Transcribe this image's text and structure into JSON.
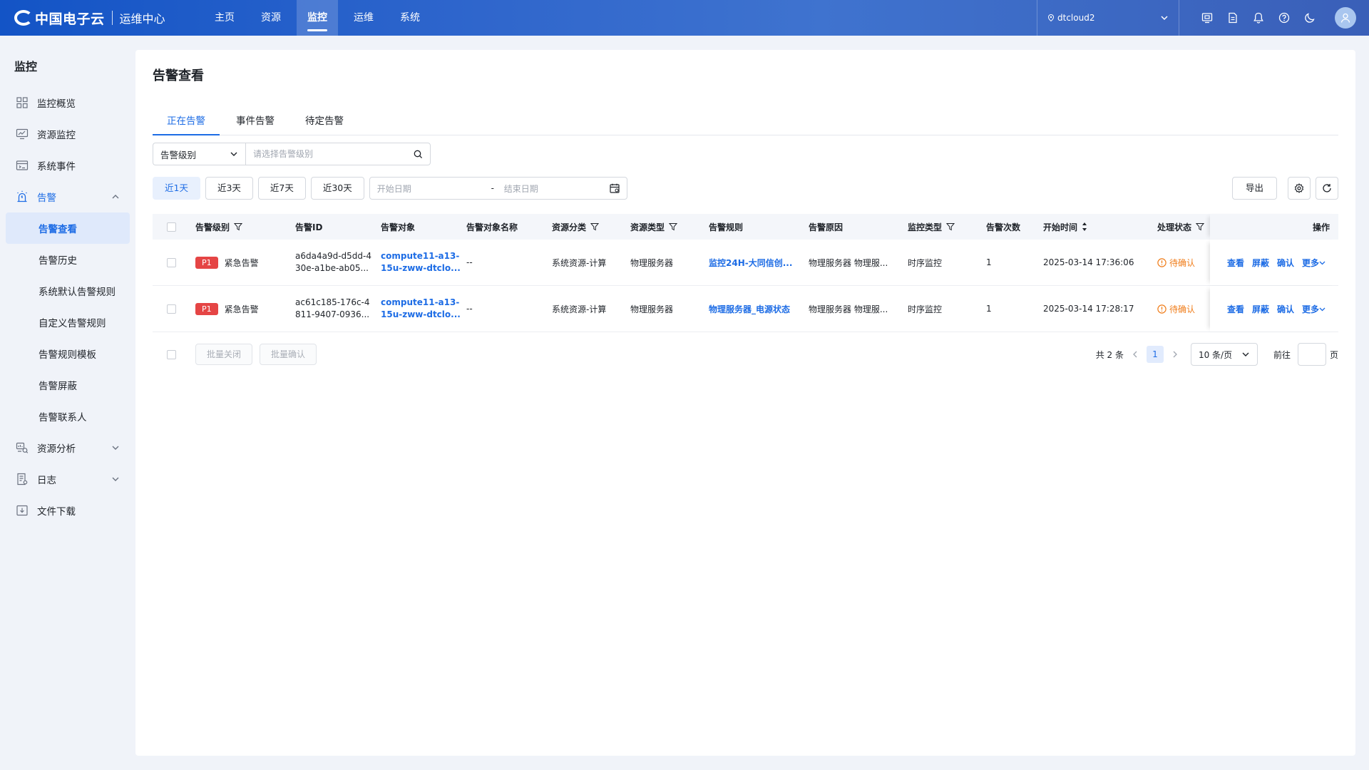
{
  "brand": {
    "name": "中国电子云",
    "sub": "运维中心"
  },
  "nav": [
    {
      "label": "主页"
    },
    {
      "label": "资源"
    },
    {
      "label": "监控",
      "active": true
    },
    {
      "label": "运维"
    },
    {
      "label": "系统"
    }
  ],
  "tenant": {
    "name": "dtcloud2"
  },
  "sidebar": {
    "title": "监控",
    "items": [
      {
        "label": "监控概览"
      },
      {
        "label": "资源监控"
      },
      {
        "label": "系统事件"
      },
      {
        "label": "告警"
      },
      {
        "label": "告警查看"
      },
      {
        "label": "告警历史"
      },
      {
        "label": "系统默认告警规则"
      },
      {
        "label": "自定义告警规则"
      },
      {
        "label": "告警规则模板"
      },
      {
        "label": "告警屏蔽"
      },
      {
        "label": "告警联系人"
      },
      {
        "label": "资源分析"
      },
      {
        "label": "日志"
      },
      {
        "label": "文件下载"
      }
    ]
  },
  "page": {
    "title": "告警查看"
  },
  "tabs": [
    {
      "label": "正在告警"
    },
    {
      "label": "事件告警"
    },
    {
      "label": "待定告警"
    }
  ],
  "filter": {
    "select_value": "告警级别",
    "search_placeholder": "请选择告警级别"
  },
  "quick_dates": [
    {
      "label": "近1天"
    },
    {
      "label": "近3天"
    },
    {
      "label": "近7天"
    },
    {
      "label": "近30天"
    }
  ],
  "daterange": {
    "start_placeholder": "开始日期",
    "separator": "-",
    "end_placeholder": "结束日期"
  },
  "toolbar": {
    "export_label": "导出"
  },
  "table": {
    "headers": {
      "level": "告警级别",
      "id": "告警ID",
      "object": "告警对象",
      "object_name": "告警对象名称",
      "res_class": "资源分类",
      "res_type": "资源类型",
      "rule": "告警规则",
      "reason": "告警原因",
      "mon_type": "监控类型",
      "count": "告警次数",
      "start": "开始时间",
      "status": "处理状态",
      "ops": "操作"
    },
    "rows": [
      {
        "badge": "P1",
        "level": "紧急告警",
        "id_l1": "a6da4a9d-d5dd-4",
        "id_l2": "30e-a1be-ab05...",
        "obj_l1": "compute11-a13-",
        "obj_l2": "15u-zww-dtclo...",
        "object_name": "--",
        "res_class": "系统资源-计算",
        "res_type": "物理服务器",
        "rule": "监控24H-大同信创...",
        "reason": "物理服务器 物理服...",
        "mon_type": "时序监控",
        "count": "1",
        "start": "2025-03-14 17:36:06",
        "status": "待确认"
      },
      {
        "badge": "P1",
        "level": "紧急告警",
        "id_l1": "ac61c185-176c-4",
        "id_l2": "811-9407-0936...",
        "obj_l1": "compute11-a13-",
        "obj_l2": "15u-zww-dtclo...",
        "object_name": "--",
        "res_class": "系统资源-计算",
        "res_type": "物理服务器",
        "rule": "物理服务器_电源状态",
        "reason": "物理服务器 物理服...",
        "mon_type": "时序监控",
        "count": "1",
        "start": "2025-03-14 17:28:17",
        "status": "待确认"
      }
    ],
    "ops": {
      "view": "查看",
      "mask": "屏蔽",
      "confirm": "确认",
      "more": "更多"
    }
  },
  "batch": {
    "close": "批量关闭",
    "confirm": "批量确认"
  },
  "pager": {
    "total": "共 2 条",
    "current": "1",
    "size": "10 条/页",
    "goto": "前往",
    "page_unit": "页"
  },
  "colors": {
    "accent": "#1d6ce5",
    "danger": "#e54545",
    "warning": "#f07d1a",
    "topbar": "#2f66cc"
  }
}
